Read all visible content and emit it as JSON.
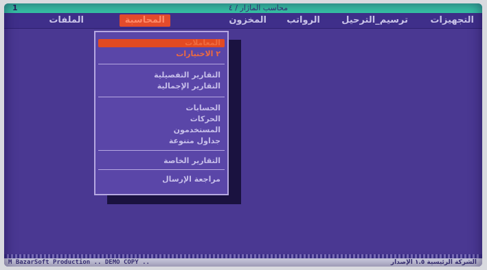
{
  "window": {
    "number": "1",
    "title": "محاسب الماژار / ٤"
  },
  "menubar": {
    "items": [
      {
        "label": "التجهيزات"
      },
      {
        "label": "ترسيم_الترحيل"
      },
      {
        "label": "الرواتب"
      },
      {
        "label": "المخزون"
      },
      {
        "label": "المحاسبة"
      },
      {
        "label": "الملفات"
      }
    ]
  },
  "dropdown": {
    "items": [
      {
        "label": "المعاملات"
      },
      {
        "label": "٢ الاختيارات"
      },
      {
        "label": "التقارير التفصيلية"
      },
      {
        "label": "التقارير الإجمالية"
      },
      {
        "label": "الحسابات"
      },
      {
        "label": "الحركات"
      },
      {
        "label": "المستخدمون"
      },
      {
        "label": "جداول متنوعة"
      },
      {
        "label": "التقارير الخاصة"
      },
      {
        "label": "مراجعة الإرسال"
      }
    ]
  },
  "statusbar": {
    "left": "M BazarSoft Production .. DEMO COPY ..",
    "right": "الشركة الرئيسية  ١.٥ الإصدار"
  },
  "colors": {
    "screen_bg": "#4a3892",
    "titlebar": "#37c4a6",
    "highlight": "#e34b2c",
    "dropdown_bg": "#5a46a8"
  }
}
